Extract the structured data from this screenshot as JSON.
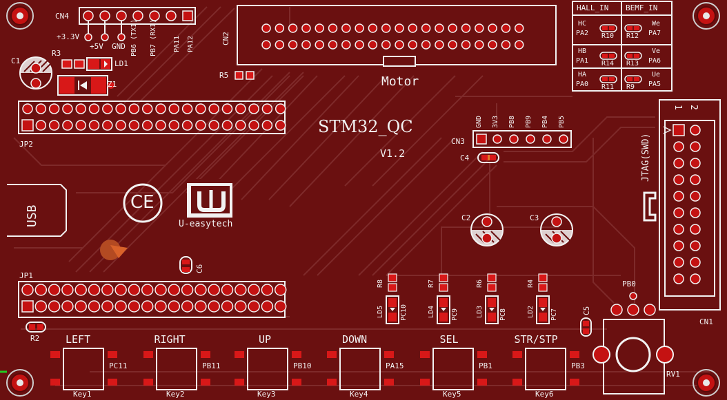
{
  "board": {
    "title": "STM32_QC",
    "version": "V1.2",
    "logo_text": "U-easytech",
    "ce_mark": "CE",
    "usb_label": "USB",
    "motor_label": "Motor",
    "jtag_label": "JTAG(SWD)",
    "colors": {
      "board": "#6a1010",
      "pad": "#d81818",
      "silk": "#f2f2f2",
      "trace": "#7e2a2a"
    }
  },
  "designators": {
    "cn1": "CN1",
    "cn2": "CN2",
    "cn3": "CN3",
    "cn4": "CN4",
    "jp1": "JP1",
    "jp2": "JP2",
    "c1": "C1",
    "c2": "C2",
    "c3": "C3",
    "c4": "C4",
    "c5": "C5",
    "c6": "C6",
    "r2": "R2",
    "r3": "R3",
    "r4": "R4",
    "r5": "R5",
    "r6": "R6",
    "r7": "R7",
    "r8": "R8",
    "ld1": "LD1",
    "ld2": "LD2",
    "ld3": "LD3",
    "ld4": "LD4",
    "ld5": "LD5",
    "z1": "Z1",
    "rv1": "RV1",
    "pb0": "PB0"
  },
  "cn4_pins": [
    "+3.3V",
    "+5V",
    "GND",
    "PB6 (TX1)",
    "PB7 (RX1)",
    "PA11",
    "PA12"
  ],
  "cn3_pins": [
    "GND",
    "3V3",
    "PB8",
    "PB9",
    "PB4",
    "PB5"
  ],
  "cn1_numbers": [
    "1",
    "2"
  ],
  "hall_table": {
    "headers": [
      "HALL_IN",
      "BEMF_IN"
    ],
    "rows": [
      {
        "hall": "HC",
        "hall_pin": "PA2",
        "r1": "R10",
        "r2": "R12",
        "bemf": "We",
        "bemf_pin": "PA7"
      },
      {
        "hall": "HB",
        "hall_pin": "PA1",
        "r1": "R14",
        "r2": "R13",
        "bemf": "Ve",
        "bemf_pin": "PA6"
      },
      {
        "hall": "HA",
        "hall_pin": "PA0",
        "r1": "R11",
        "r2": "R9",
        "bemf": "Ue",
        "bemf_pin": "PA5"
      }
    ]
  },
  "leds": [
    {
      "ld": "LD5",
      "pin": "PC10",
      "r": "R8"
    },
    {
      "ld": "LD4",
      "pin": "PC9",
      "r": "R7"
    },
    {
      "ld": "LD3",
      "pin": "PC8",
      "r": "R6"
    },
    {
      "ld": "LD2",
      "pin": "PC7",
      "r": "R4"
    }
  ],
  "keys": [
    {
      "title": "LEFT",
      "pin": "PC11",
      "key": "Key1"
    },
    {
      "title": "RIGHT",
      "pin": "PB11",
      "key": "Key2"
    },
    {
      "title": "UP",
      "pin": "PB10",
      "key": "Key3"
    },
    {
      "title": "DOWN",
      "pin": "PA15",
      "key": "Key4"
    },
    {
      "title": "SEL",
      "pin": "PB1",
      "key": "Key5"
    },
    {
      "title": "STR/STP",
      "pin": "PB3",
      "key": "Key6"
    }
  ]
}
